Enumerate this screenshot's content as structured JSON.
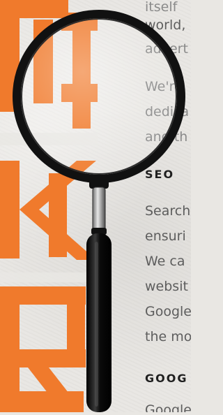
{
  "article": {
    "intro_lines": [
      "itself",
      "world,",
      "advert"
    ],
    "para2_lines": [
      "We're",
      "dedica",
      "and th"
    ],
    "seo_heading": "SEO",
    "seo_lines": [
      "Search",
      "ensuri",
      "We ca",
      "websit",
      "Google",
      "the mo"
    ],
    "google_heading": "GOOG",
    "google_line": "Google"
  },
  "decor": {
    "background_word_letters": [
      "K",
      "E",
      "T"
    ],
    "accent_color": "#f07a2c"
  }
}
